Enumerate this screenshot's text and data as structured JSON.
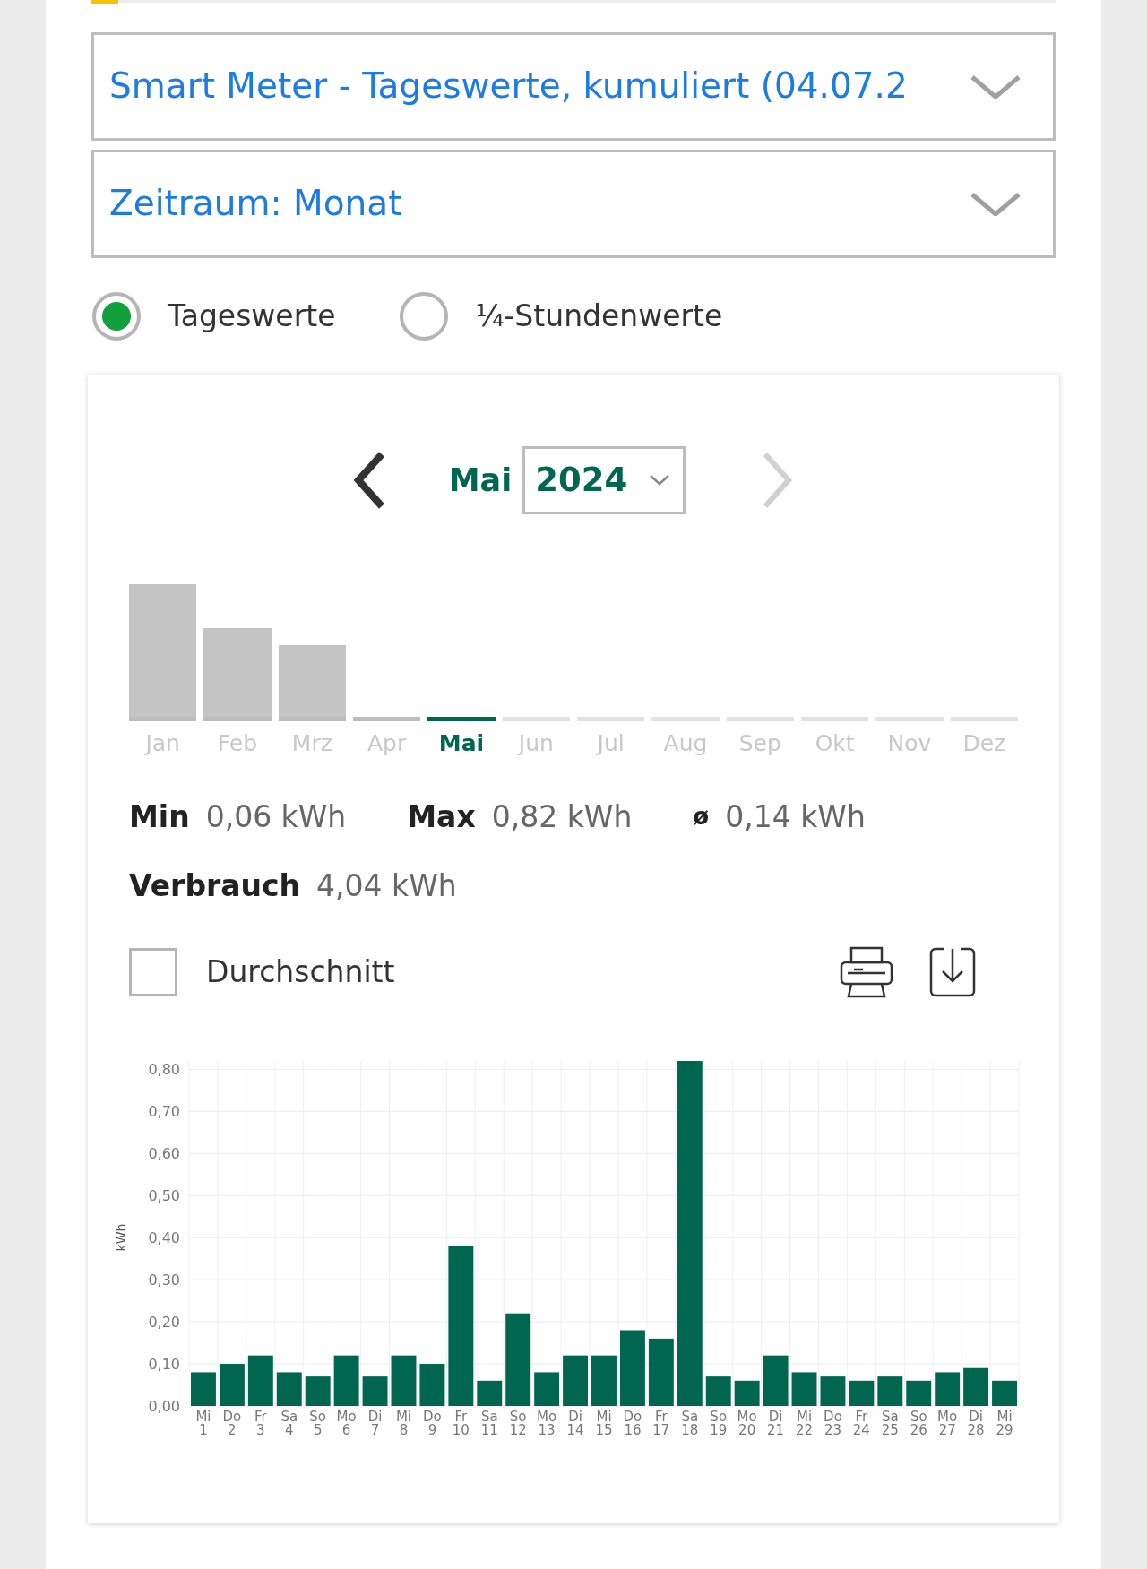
{
  "dropdowns": [
    {
      "value": "Smart Meter - Tageswerte, kumuliert (04.07.2"
    },
    {
      "value": "Zeitraum: Monat"
    }
  ],
  "view_options": [
    {
      "label": "Tageswerte",
      "selected": true
    },
    {
      "label": "¼-Stundenwerte",
      "selected": false
    }
  ],
  "period": {
    "month": "Mai",
    "year": "2024",
    "prev_disabled": false,
    "next_disabled": true
  },
  "months": [
    {
      "label": "Jan",
      "level": 1,
      "has_data": true,
      "selected": false
    },
    {
      "label": "Feb",
      "level": 0.67,
      "has_data": true,
      "selected": false
    },
    {
      "label": "Mrz",
      "level": 0.54,
      "has_data": true,
      "selected": false
    },
    {
      "label": "Apr",
      "level": 0,
      "has_data": true,
      "selected": false
    },
    {
      "label": "Mai",
      "level": 0,
      "has_data": true,
      "selected": true
    },
    {
      "label": "Jun",
      "level": 0,
      "has_data": false,
      "selected": false
    },
    {
      "label": "Jul",
      "level": 0,
      "has_data": false,
      "selected": false
    },
    {
      "label": "Aug",
      "level": 0,
      "has_data": false,
      "selected": false
    },
    {
      "label": "Sep",
      "level": 0,
      "has_data": false,
      "selected": false
    },
    {
      "label": "Okt",
      "level": 0,
      "has_data": false,
      "selected": false
    },
    {
      "label": "Nov",
      "level": 0,
      "has_data": false,
      "selected": false
    },
    {
      "label": "Dez",
      "level": 0,
      "has_data": false,
      "selected": false
    }
  ],
  "stats": [
    {
      "label": "Min",
      "value": "0,06 kWh"
    },
    {
      "label": "Max",
      "value": "0,82 kWh"
    },
    {
      "label": "ø",
      "value": "0,14 kWh"
    },
    {
      "label": "Verbrauch",
      "value": "4,04 kWh"
    }
  ],
  "average_checkbox": {
    "label": "Durchschnitt",
    "checked": false
  },
  "chart": {
    "chart_data": {
      "type": "bar",
      "ylabel": "kWh",
      "categories": [
        "Mi 1",
        "Do 2",
        "Fr 3",
        "Sa 4",
        "So 5",
        "Mo 6",
        "Di 7",
        "Mi 8",
        "Do 9",
        "Fr 10",
        "Sa 11",
        "So 12",
        "Mo 13",
        "Di 14",
        "Mi 15",
        "Do 16",
        "Fr 17",
        "Sa 18",
        "So 19",
        "Mo 20",
        "Di 21",
        "Mi 22",
        "Do 23",
        "Fr 24",
        "Sa 25",
        "So 26",
        "Mo 27",
        "Di 28",
        "Mi 29"
      ],
      "grid": true,
      "ylim": [
        0,
        0.82
      ],
      "series": [
        {
          "color": "#00664f",
          "values": [
            0.08,
            0.1,
            0.12,
            0.08,
            0.07,
            0.12,
            0.07,
            0.12,
            0.1,
            0.38,
            0.06,
            0.22,
            0.08,
            0.12,
            0.12,
            0.18,
            0.16,
            0.82,
            0.07,
            0.06,
            0.12,
            0.08,
            0.07,
            0.06,
            0.07,
            0.06,
            0.08,
            0.09,
            0.06
          ]
        }
      ],
      "yticks": [
        {
          "value": 0,
          "label": "0,00"
        },
        {
          "value": 0.1,
          "label": "0,10"
        },
        {
          "value": 0.2,
          "label": "0,20"
        },
        {
          "value": 0.3,
          "label": "0,30"
        },
        {
          "value": 0.4,
          "label": "0,40"
        },
        {
          "value": 0.5,
          "label": "0,50"
        },
        {
          "value": 0.6,
          "label": "0,60"
        },
        {
          "value": 0.7,
          "label": "0,70"
        },
        {
          "value": 0.8,
          "label": "0,80"
        }
      ]
    }
  }
}
